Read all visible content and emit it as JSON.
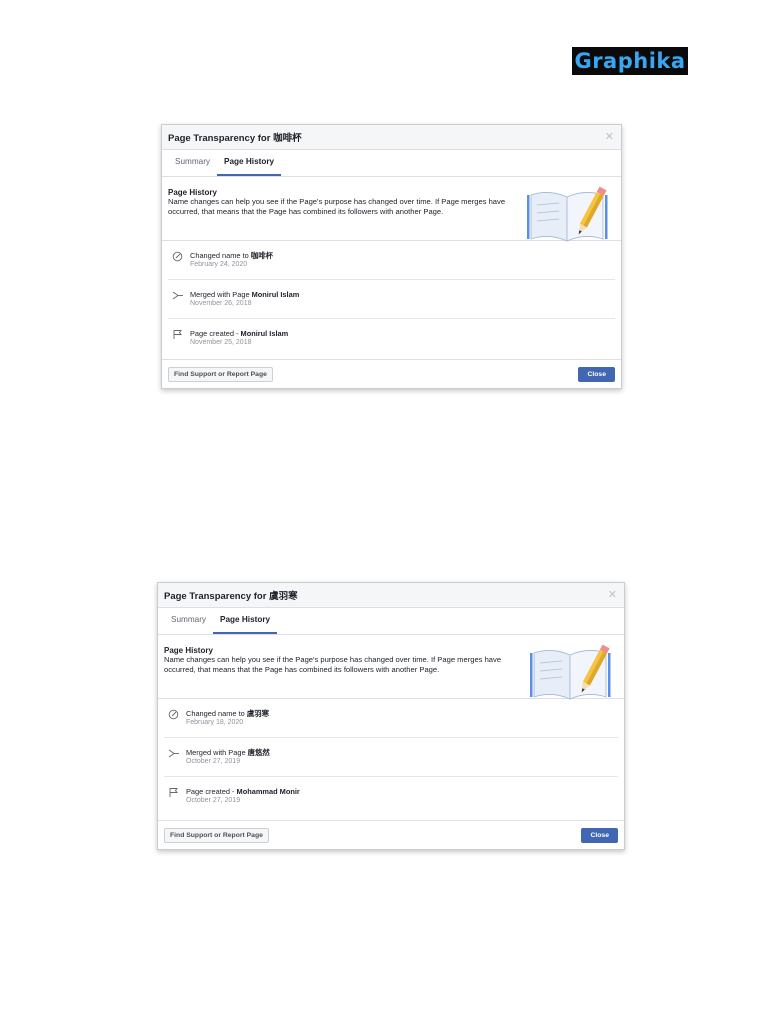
{
  "logo": {
    "text": "Graphika"
  },
  "dialogs": [
    {
      "title": "Page Transparency for 咖啡杯",
      "tabs": [
        {
          "label": "Summary"
        },
        {
          "label": "Page History"
        }
      ],
      "intro": {
        "title": "Page History",
        "body": "Name changes can help you see if the Page's purpose has changed over time. If Page merges have occurred, that means that the Page has combined its followers with another Page."
      },
      "entries": [
        {
          "icon": "edit-name-icon",
          "prefix": "Changed name to ",
          "name": "咖啡杯",
          "date": "February 24, 2020"
        },
        {
          "icon": "merge-icon",
          "prefix": "Merged with Page ",
          "name": "Monirul Islam",
          "date": "November 26, 2018"
        },
        {
          "icon": "flag-icon",
          "prefix": "Page created - ",
          "name": "Monirul Islam",
          "date": "November 25, 2018"
        }
      ],
      "support_label": "Find Support or Report Page",
      "close_label": "Close"
    },
    {
      "title": "Page Transparency for 虞羽寒",
      "tabs": [
        {
          "label": "Summary"
        },
        {
          "label": "Page History"
        }
      ],
      "intro": {
        "title": "Page History",
        "body": "Name changes can help you see if the Page's purpose has changed over time. If Page merges have occurred, that means that the Page has combined its followers with another Page."
      },
      "entries": [
        {
          "icon": "edit-name-icon",
          "prefix": "Changed name to ",
          "name": "虞羽寒",
          "date": "February 18, 2020"
        },
        {
          "icon": "merge-icon",
          "prefix": "Merged with Page ",
          "name": "唐悠然",
          "date": "October 27, 2019"
        },
        {
          "icon": "flag-icon",
          "prefix": "Page created - ",
          "name": "Mohammad Monir",
          "date": "October 27, 2019"
        }
      ],
      "support_label": "Find Support or Report Page",
      "close_label": "Close"
    }
  ]
}
